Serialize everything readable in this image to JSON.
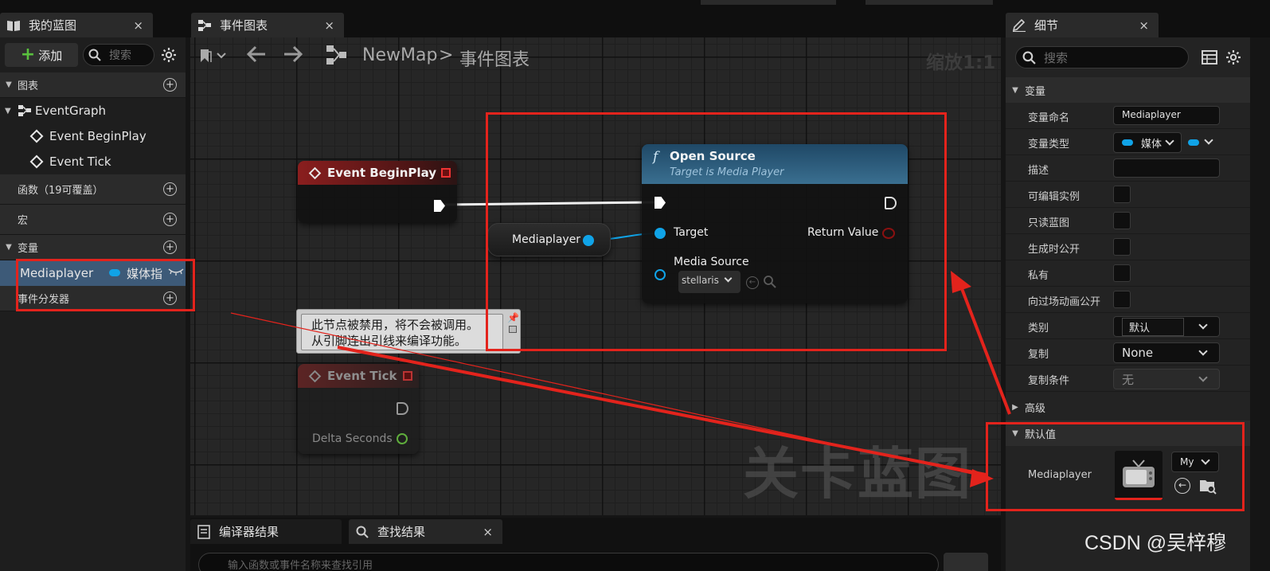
{
  "tabs": {
    "my_blueprint": "我的蓝图",
    "event_graph": "事件图表",
    "details": "细节",
    "close": "×"
  },
  "left_panel": {
    "add_label": "添加",
    "search_placeholder": "搜索",
    "sections": {
      "graphs": "图表",
      "functions": "函数（19可覆盖）",
      "macros": "宏",
      "variables": "变量",
      "dispatchers": "事件分发器"
    },
    "tree": {
      "event_graph": "EventGraph",
      "begin_play": "Event BeginPlay",
      "tick": "Event Tick"
    },
    "variable": {
      "name": "Mediaplayer",
      "type": "媒体指"
    }
  },
  "graph": {
    "breadcrumb_map": "NewMap",
    "breadcrumb_sep": ">",
    "breadcrumb_graph": "事件图表",
    "zoom": "缩放1:1",
    "watermark": "关卡蓝图",
    "nodes": {
      "begin_play": {
        "title": "Event BeginPlay"
      },
      "get_var": {
        "label": "Mediaplayer"
      },
      "open_source": {
        "func_icon": "f",
        "title": "Open Source",
        "subtitle": "Target is Media Player",
        "target_pin": "Target",
        "return_pin": "Return Value",
        "media_source_pin": "Media Source",
        "media_source_value": "stellaris"
      },
      "comment": {
        "line1": "此节点被禁用，将不会被调用。",
        "line2": "从引脚连出引线来编译功能。"
      },
      "tick": {
        "title": "Event Tick",
        "delta_pin": "Delta Seconds"
      }
    }
  },
  "bottom": {
    "compiler_results": "编译器结果",
    "find_results": "查找结果",
    "find_placeholder": "输入函数或事件名称来查找引用"
  },
  "details": {
    "search_placeholder": "搜索",
    "section_variable": "变量",
    "rows": [
      {
        "label": "变量命名",
        "value": "Mediaplayer"
      },
      {
        "label": "变量类型",
        "value": "媒体"
      },
      {
        "label": "描述",
        "value": ""
      },
      {
        "label": "可编辑实例"
      },
      {
        "label": "只读蓝图"
      },
      {
        "label": "生成时公开"
      },
      {
        "label": "私有"
      },
      {
        "label": "向过场动画公开"
      },
      {
        "label": "类别",
        "value": "默认"
      },
      {
        "label": "复制",
        "value": "None"
      },
      {
        "label": "复制条件",
        "value": "无"
      }
    ],
    "section_advanced": "高级",
    "section_defaults": "默认值",
    "default_label": "Mediaplayer",
    "default_value": "My"
  },
  "watermark_csdn": "CSDN @吴梓穆",
  "colors": {
    "accent_blue": "#10a3e7",
    "annotation_red": "#e3231c",
    "event_red": "#8a1e1e",
    "function_blue": "#3a6f90"
  }
}
